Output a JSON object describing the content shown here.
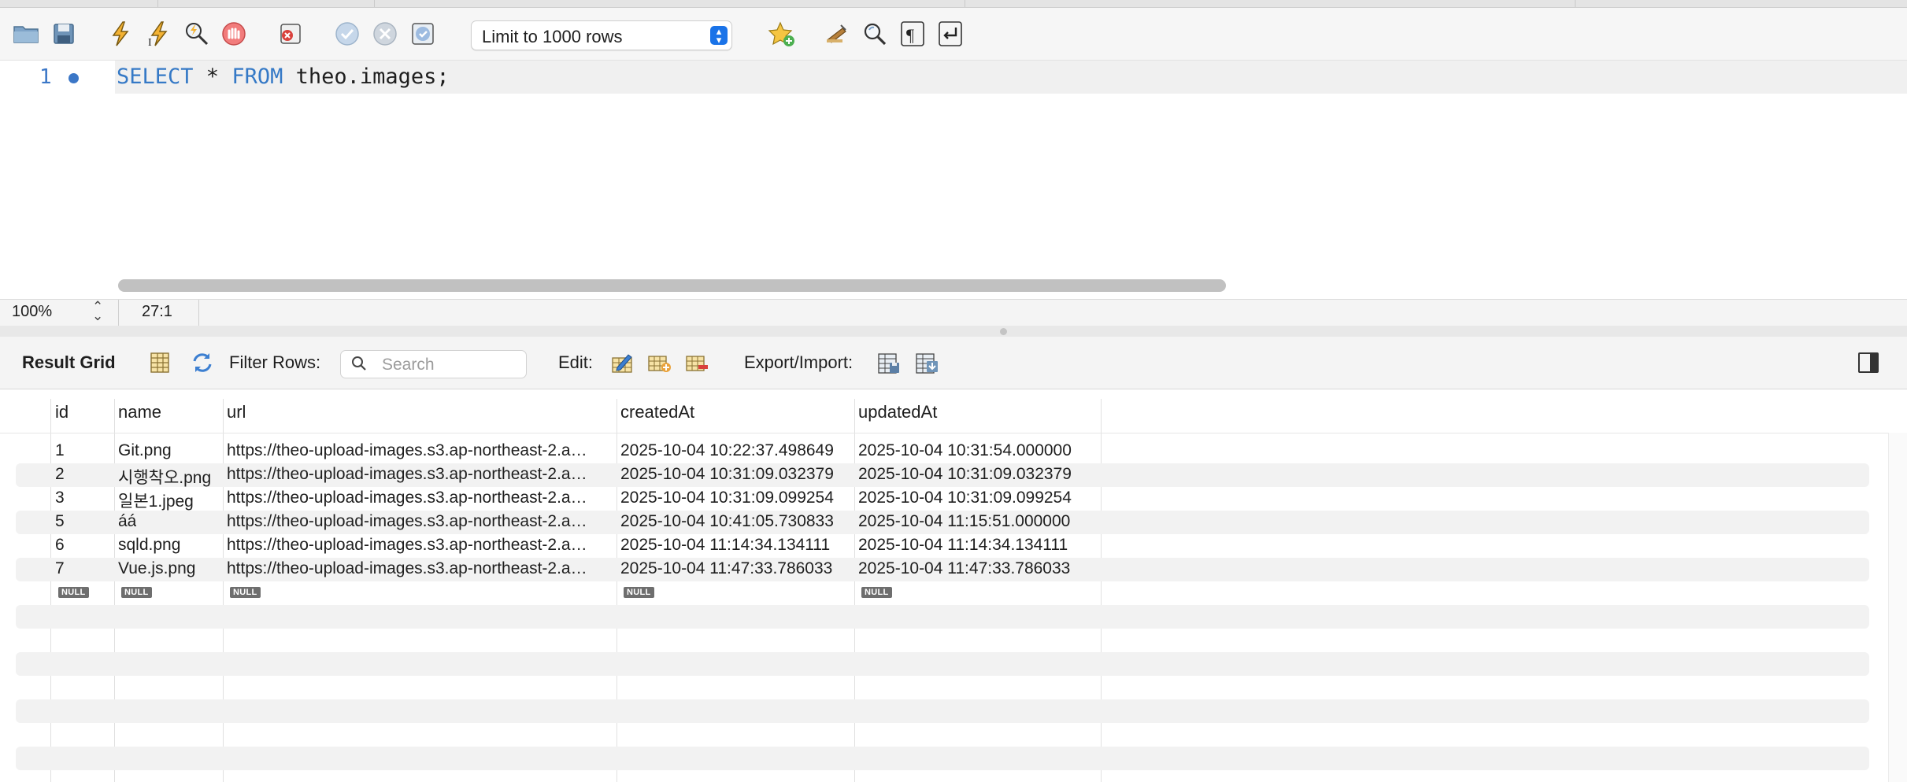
{
  "toolbar": {
    "icons": [
      "open-folder-icon",
      "save-icon",
      "execute-icon",
      "execute-current-icon",
      "explain-icon",
      "stop-icon",
      "toggle-error-icon",
      "commit-icon",
      "rollback-icon",
      "autocommit-icon",
      "add-snippet-icon",
      "beautify-icon",
      "find-icon",
      "invisible-chars-icon",
      "wrap-icon"
    ],
    "limit_label": "Limit to 1000 rows"
  },
  "editor": {
    "line_number": "1",
    "code_keywords": [
      "SELECT",
      "FROM"
    ],
    "code_star": " * ",
    "code_rest": " theo.images;"
  },
  "status": {
    "zoom": "100%",
    "cursor": "27:1"
  },
  "result_toolbar": {
    "title": "Result Grid",
    "filter_label": "Filter Rows:",
    "search_placeholder": "Search",
    "edit_label": "Edit:",
    "export_label": "Export/Import:"
  },
  "grid": {
    "columns": [
      "id",
      "name",
      "url",
      "createdAt",
      "updatedAt"
    ],
    "rows": [
      [
        "1",
        "Git.png",
        "https://theo-upload-images.s3.ap-northeast-2.a…",
        "2025-10-04 10:22:37.498649",
        "2025-10-04 10:31:54.000000"
      ],
      [
        "2",
        "시행착오.png",
        "https://theo-upload-images.s3.ap-northeast-2.a…",
        "2025-10-04 10:31:09.032379",
        "2025-10-04 10:31:09.032379"
      ],
      [
        "3",
        "일본1.jpeg",
        "https://theo-upload-images.s3.ap-northeast-2.a…",
        "2025-10-04 10:31:09.099254",
        "2025-10-04 10:31:09.099254"
      ],
      [
        "5",
        "áá",
        "https://theo-upload-images.s3.ap-northeast-2.a…",
        "2025-10-04 10:41:05.730833",
        "2025-10-04 11:15:51.000000"
      ],
      [
        "6",
        "sqld.png",
        "https://theo-upload-images.s3.ap-northeast-2.a…",
        "2025-10-04 11:14:34.134111",
        "2025-10-04 11:14:34.134111"
      ],
      [
        "7",
        "Vue.js.png",
        "https://theo-upload-images.s3.ap-northeast-2.a…",
        "2025-10-04 11:47:33.786033",
        "2025-10-04 11:47:33.786033"
      ]
    ],
    "null_label": "NULL"
  }
}
